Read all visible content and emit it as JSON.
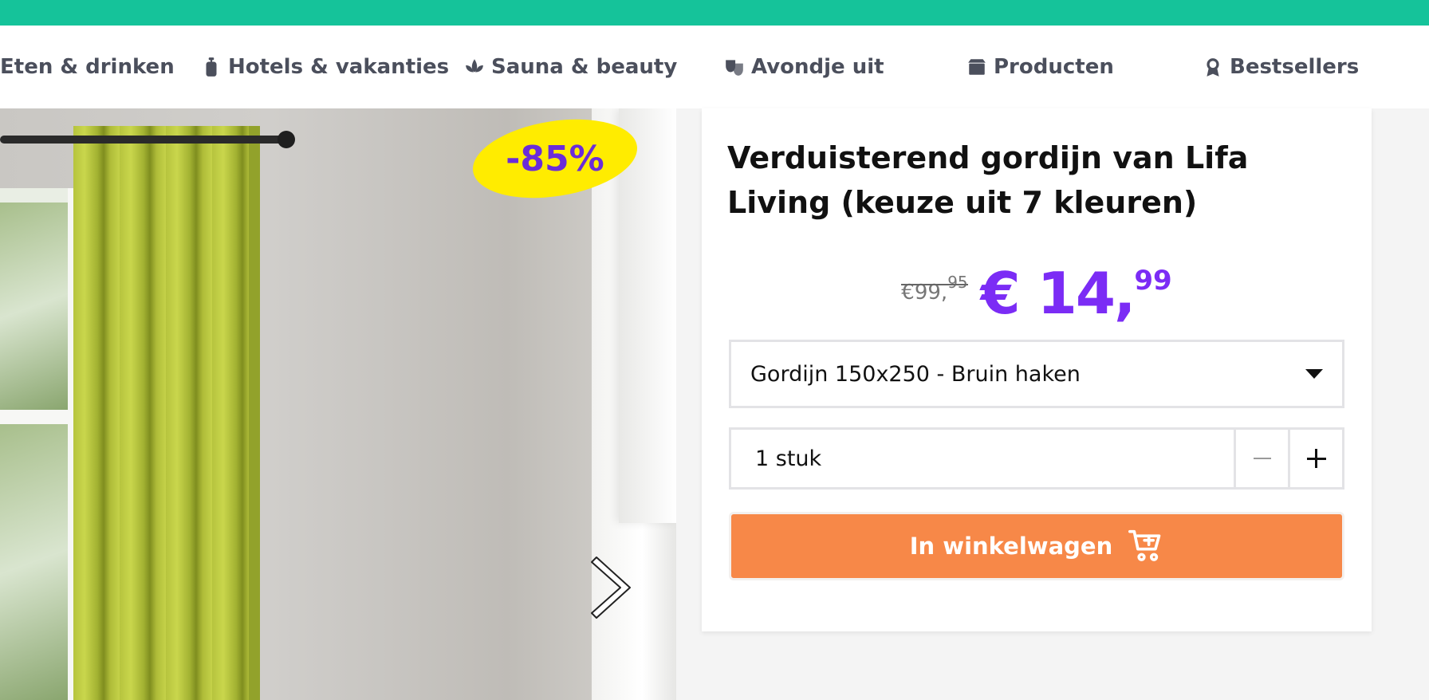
{
  "nav": {
    "items": [
      {
        "label": "Eten & drinken",
        "icon": "fork-knife-icon"
      },
      {
        "label": "Hotels & vakanties",
        "icon": "suitcase-icon"
      },
      {
        "label": "Sauna & beauty",
        "icon": "lotus-icon"
      },
      {
        "label": "Avondje uit",
        "icon": "theater-masks-icon"
      },
      {
        "label": "Producten",
        "icon": "box-icon"
      },
      {
        "label": "Bestsellers",
        "icon": "award-icon"
      }
    ]
  },
  "hero": {
    "discount_badge": "-85%",
    "next_icon": "chevron-right-icon"
  },
  "product": {
    "title": "Verduisterend gordijn van Lifa Living (keuze uit 7 kleuren)",
    "old_price_main": "€99,",
    "old_price_cents": "95",
    "new_price_main": "€ 14,",
    "new_price_cents": "99",
    "variant_selected": "Gordijn 150x250 - Bruin haken",
    "quantity_label": "1 stuk",
    "cart_button_label": "In winkelwagen"
  },
  "colors": {
    "topbar": "#15c39a",
    "price_accent": "#7b2cf5",
    "badge_bg": "#ffec00",
    "cta": "#f78848"
  }
}
